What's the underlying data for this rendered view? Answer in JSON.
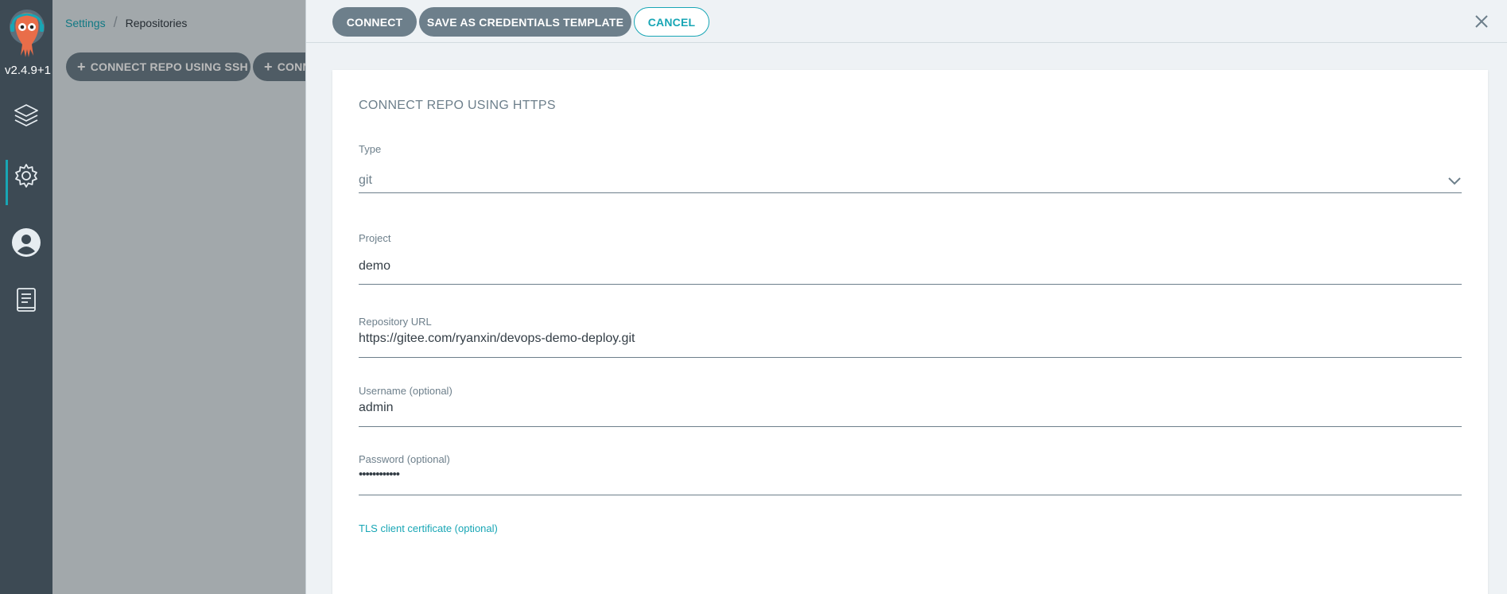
{
  "nav": {
    "version": "v2.4.9+1",
    "items": [
      {
        "name": "applications",
        "icon": "layers-icon"
      },
      {
        "name": "settings",
        "icon": "gear-icon"
      },
      {
        "name": "user-info",
        "icon": "user-icon"
      },
      {
        "name": "docs",
        "icon": "book-icon"
      }
    ]
  },
  "breadcrumb": {
    "parent": "Settings",
    "current": "Repositories"
  },
  "background_toolbar": {
    "ssh_label": "CONNECT REPO USING SSH",
    "next_label": "CONN"
  },
  "panel": {
    "connect_label": "CONNECT",
    "save_template_label": "SAVE AS CREDENTIALS TEMPLATE",
    "cancel_label": "CANCEL",
    "title": "CONNECT REPO USING HTTPS",
    "type": {
      "label": "Type",
      "value": "git"
    },
    "project": {
      "label": "Project",
      "value": "demo"
    },
    "repo_url": {
      "label": "Repository URL",
      "value": "https://gitee.com/ryanxin/devops-demo-deploy.git"
    },
    "username": {
      "label": "Username (optional)",
      "value": "admin"
    },
    "password": {
      "label": "Password (optional)",
      "value": "••••••••••••"
    },
    "tls_link": "TLS client certificate (optional)"
  },
  "colors": {
    "accent": "#18a6b5",
    "button": "#6d7f8b",
    "nav": "#3d4a54"
  }
}
